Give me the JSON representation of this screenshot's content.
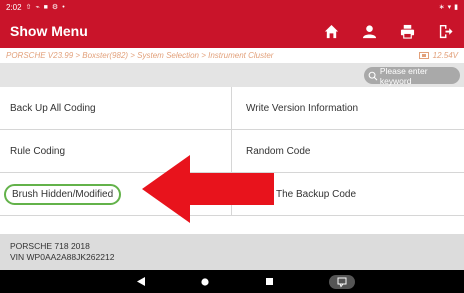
{
  "status_bar": {
    "time": "2:02"
  },
  "header": {
    "title": "Show Menu",
    "icons": [
      "home-icon",
      "user-icon",
      "print-icon",
      "exit-icon"
    ]
  },
  "breadcrumb": {
    "path": "PORSCHE V23.99 > Boxster(982) > System Selection > Instrument Cluster",
    "voltage": "12.54V"
  },
  "search": {
    "placeholder": "Please enter keyword"
  },
  "menu": {
    "rows": [
      {
        "left": "Back Up All Coding",
        "right": "Write Version Information"
      },
      {
        "left": "Rule Coding",
        "right": "Random Code"
      },
      {
        "left": "Brush Hidden/Modified",
        "right": "The Backup Code"
      }
    ]
  },
  "vehicle": {
    "model": "PORSCHE 718 2018",
    "vin": "VIN WP0AA2A88JK262212"
  },
  "colors": {
    "brand_red": "#c9142a",
    "highlight_green": "#63b24a",
    "arrow_red": "#e8131c"
  }
}
